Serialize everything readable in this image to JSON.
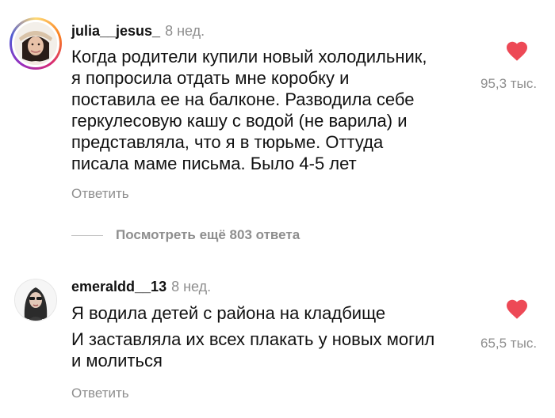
{
  "comments": [
    {
      "username": "julia__jesus_",
      "time": "8 нед.",
      "text_lines": [
        "Когда родители купили новый холодильник,",
        "я попросила отдать мне коробку и",
        "поставила ее на балконе. Разводила себе",
        "геркулесовую кашу с водой (не варила) и",
        "представляла, что я в тюрьме. Оттуда",
        "писала маме письма. Было 4-5 лет"
      ],
      "reply_label": "Ответить",
      "likes": "95,3 тыс.",
      "liked": true
    },
    {
      "username": "emeraldd__13",
      "time": "8 нед.",
      "text_lines": [
        "Я водила детей с района на кладбище",
        "И заставляла их всех плакать у новых могил",
        "и молиться"
      ],
      "reply_label": "Ответить",
      "likes": "65,5 тыс.",
      "liked": true
    }
  ],
  "view_more_replies": "Посмотреть ещё 803 ответа",
  "colors": {
    "heart": "#ed4956",
    "secondary_text": "#8e8e8e",
    "primary_text": "#111111"
  },
  "icons": {
    "like": "heart-filled-icon"
  }
}
